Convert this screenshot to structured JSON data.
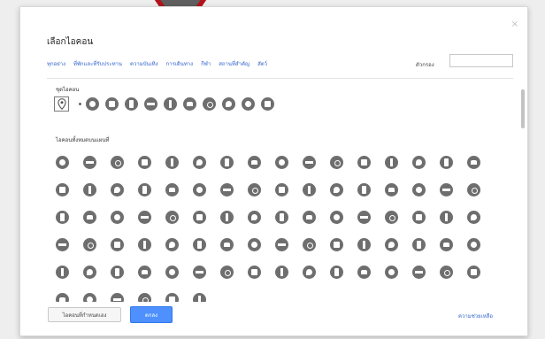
{
  "dialog": {
    "title": "เลือกไอคอน",
    "close_glyph": "×",
    "categories": [
      "ทุกอย่าง",
      "ที่พักและที่รับประทาน",
      "ความบันเทิง",
      "การเดินทาง",
      "กีฬา",
      "สถานที่สำคัญ",
      "สัตว์"
    ],
    "filter_label": "ตัวกรอง",
    "filter_value": "",
    "selected_section_title": "ชุดไอคอน",
    "list_section_title": "ไอคอนทั้งหมดบนแผนที่",
    "selected_icon": "map-pin-icon",
    "variant_icons": [
      "circle-icon",
      "square-icon",
      "circle-icon",
      "square-icon",
      "circle-icon",
      "square-icon",
      "shield-icon",
      "more-icon",
      "check-icon",
      "close-circle-icon"
    ],
    "grid_icons": [
      "icon-0",
      "icon-1",
      "icon-2",
      "icon-3",
      "icon-4",
      "icon-5",
      "icon-6",
      "icon-7",
      "icon-0",
      "icon-1",
      "icon-2",
      "icon-3",
      "icon-4",
      "icon-5",
      "icon-6",
      "icon-7",
      "icon-1",
      "icon-2",
      "icon-3",
      "icon-4",
      "icon-5",
      "icon-6",
      "icon-7",
      "icon-0",
      "icon-1",
      "icon-2",
      "icon-3",
      "icon-4",
      "icon-5",
      "icon-6",
      "icon-7",
      "icon-0",
      "icon-2",
      "icon-3",
      "icon-4",
      "icon-5",
      "icon-6",
      "icon-7",
      "icon-0",
      "icon-1",
      "icon-2",
      "icon-3",
      "icon-4",
      "icon-5",
      "icon-6",
      "icon-7",
      "icon-0",
      "icon-1",
      "icon-3",
      "icon-4",
      "icon-5",
      "icon-6",
      "icon-7",
      "icon-0",
      "icon-1",
      "icon-2",
      "icon-3",
      "icon-4",
      "icon-5",
      "icon-6",
      "icon-7",
      "icon-0",
      "icon-1",
      "icon-2",
      "icon-4",
      "icon-5",
      "icon-6",
      "icon-7",
      "icon-0",
      "icon-1",
      "icon-2",
      "icon-3",
      "icon-4",
      "icon-5",
      "icon-6",
      "icon-7",
      "icon-0",
      "icon-1",
      "icon-2",
      "icon-3",
      "icon-5",
      "icon-6",
      "icon-7",
      "icon-0",
      "icon-1",
      "icon-2"
    ],
    "buttons": {
      "secondary": "ไอคอนที่กำหนดเอง",
      "primary": "ตกลง"
    },
    "help_link": "ความช่วยเหลือ"
  },
  "colors": {
    "accent": "#4d90fe",
    "link": "#3366cc",
    "icon_fill": "#6e6e6e",
    "pointer": "#b3131b"
  }
}
